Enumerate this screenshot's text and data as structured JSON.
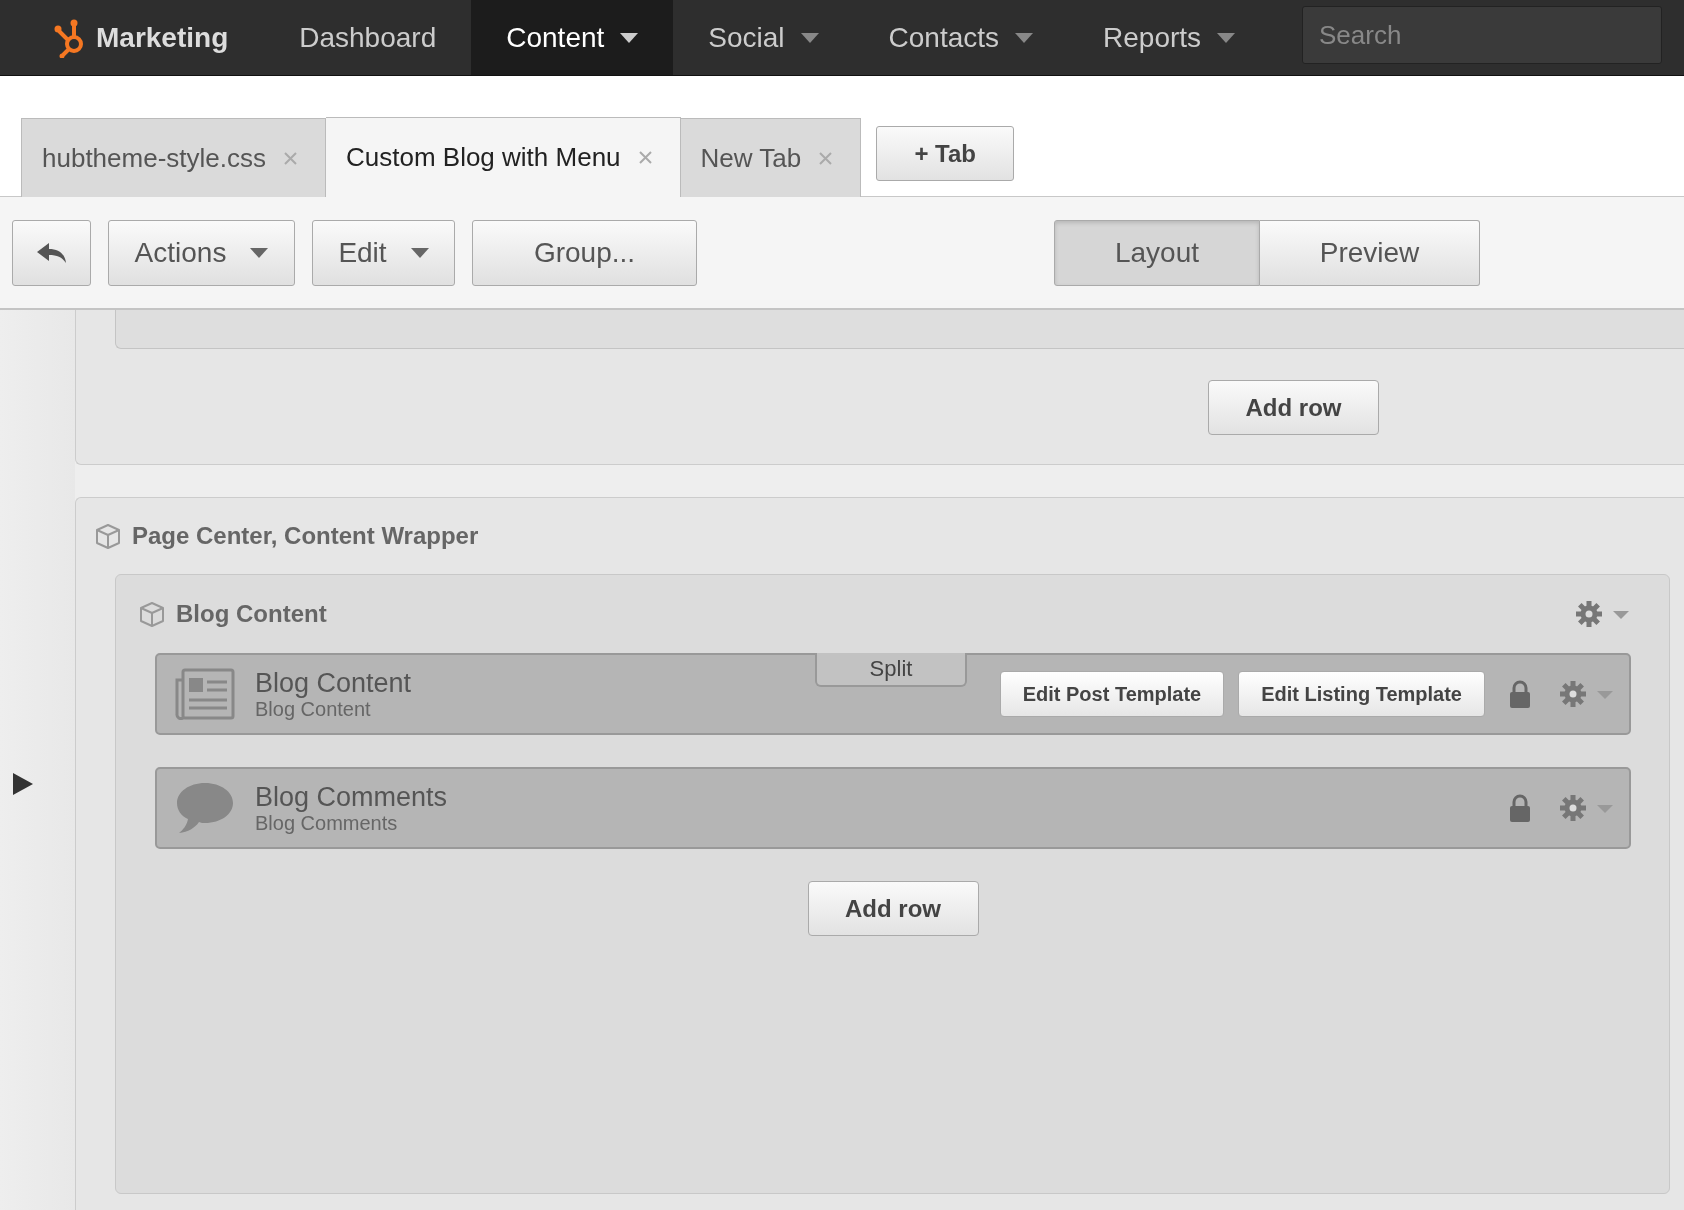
{
  "nav": {
    "brand": "Marketing",
    "items": [
      {
        "label": "Dashboard",
        "selected": false,
        "dropdown": false
      },
      {
        "label": "Content",
        "selected": true,
        "dropdown": true
      },
      {
        "label": "Social",
        "selected": false,
        "dropdown": true
      },
      {
        "label": "Contacts",
        "selected": false,
        "dropdown": true
      },
      {
        "label": "Reports",
        "selected": false,
        "dropdown": true
      }
    ],
    "search": {
      "placeholder": "Search"
    }
  },
  "tabs": [
    {
      "label": "hubtheme-style.css",
      "selected": false
    },
    {
      "label": "Custom Blog with Menu",
      "selected": true
    },
    {
      "label": "New Tab",
      "selected": false
    }
  ],
  "add_tab": "+ Tab",
  "toolbar": {
    "buttons": [
      {
        "label": "Actions",
        "dropdown": true
      },
      {
        "label": "Edit",
        "dropdown": true
      },
      {
        "label": "Group...",
        "dropdown": false
      }
    ],
    "views": [
      {
        "label": "Layout",
        "selected": true
      },
      {
        "label": "Preview",
        "selected": false
      }
    ]
  },
  "layout": {
    "top_group": {
      "add_row": "Add row"
    },
    "group": {
      "title": "Page Center, Content Wrapper",
      "section": {
        "title": "Blog Content",
        "modules": [
          {
            "kind": "blog-content",
            "title": "Blog Content",
            "subtitle": "Blog Content",
            "split": "Split",
            "actions": [
              "Edit Post Template",
              "Edit Listing Template"
            ],
            "locked": true
          },
          {
            "kind": "comments",
            "title": "Blog Comments",
            "subtitle": "Blog Comments",
            "locked": true
          }
        ],
        "add_row": "Add row"
      }
    }
  }
}
